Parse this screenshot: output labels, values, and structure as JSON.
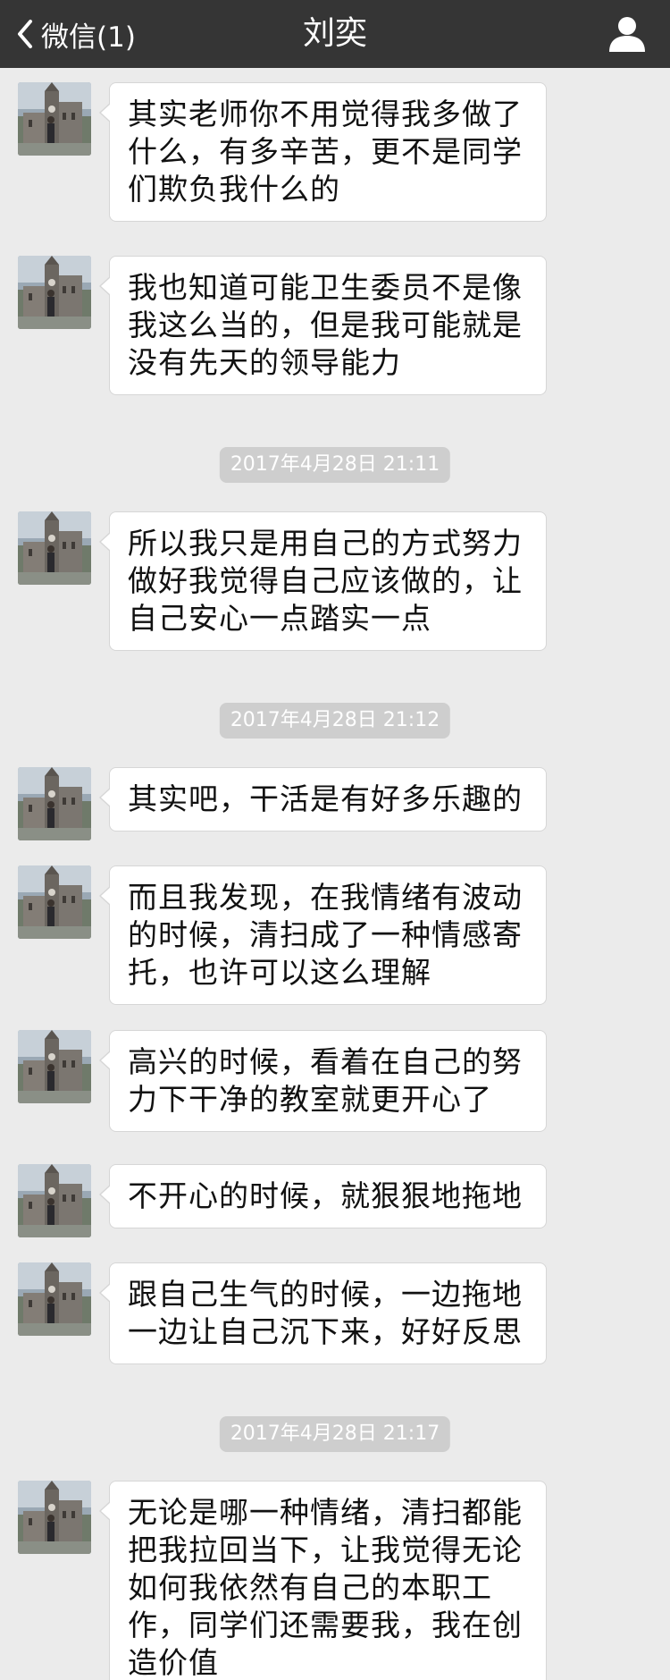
{
  "header": {
    "back_label": "微信(1)",
    "title": "刘奕"
  },
  "messages": [
    {
      "text": "其实老师你不用觉得我多做了什么，有多辛苦，更不是同学们欺负我什么的"
    },
    {
      "text": "我也知道可能卫生委员不是像我这么当的，但是我可能就是没有先天的领导能力"
    },
    {
      "timestamp": "2017年4月28日 21:11"
    },
    {
      "text": "所以我只是用自己的方式努力做好我觉得自己应该做的，让自己安心一点踏实一点"
    },
    {
      "timestamp": "2017年4月28日 21:12"
    },
    {
      "text": "其实吧，干活是有好多乐趣的"
    },
    {
      "text": "而且我发现，在我情绪有波动的时候，清扫成了一种情感寄托，也许可以这么理解"
    },
    {
      "text": "高兴的时候，看着在自己的努力下干净的教室就更开心了"
    },
    {
      "text": "不开心的时候，就狠狠地拖地"
    },
    {
      "text": "跟自己生气的时候，一边拖地一边让自己沉下来，好好反思"
    },
    {
      "timestamp": "2017年4月28日 21:17"
    },
    {
      "text": "无论是哪一种情绪，清扫都能把我拉回当下，让我觉得无论如何我依然有自己的本职工作，同学们还需要我，我在创造价值"
    }
  ]
}
